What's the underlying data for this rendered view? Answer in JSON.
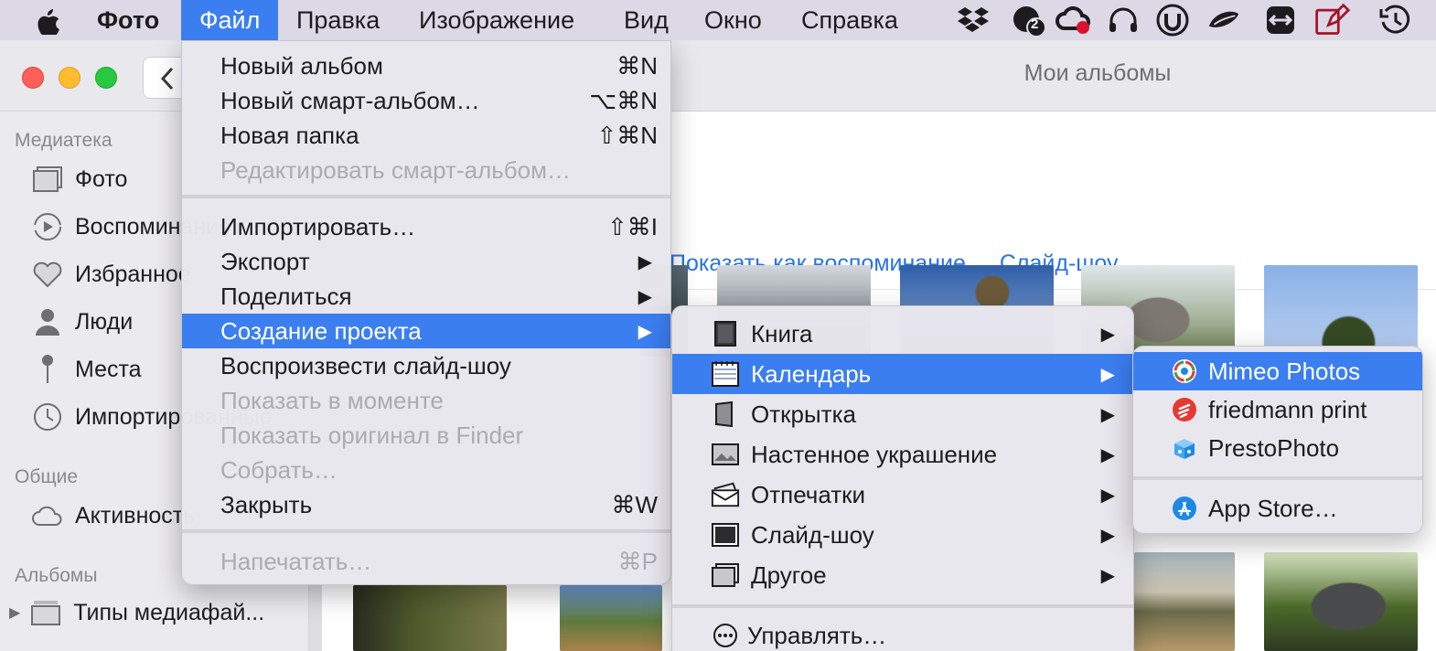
{
  "menubar": {
    "app_name": "Фото",
    "items": [
      "Файл",
      "Правка",
      "Изображение",
      "Вид",
      "Окно",
      "Справка"
    ],
    "active_item": "Файл",
    "status_icons": [
      "dropbox-icon",
      "badge-app-icon",
      "creative-cloud-icon",
      "headphones-icon",
      "utorrent-icon",
      "sync-app-icon",
      "rotate-icon",
      "teamviewer-icon",
      "note-edit-icon",
      "time-machine-icon"
    ],
    "badge_count": "2"
  },
  "window": {
    "title": "Мои альбомы"
  },
  "sidebar": {
    "sections": [
      {
        "heading": "Медиатека",
        "items": [
          {
            "label": "Фото",
            "icon": "photos-icon"
          },
          {
            "label": "Воспоминания",
            "icon": "memories-icon"
          },
          {
            "label": "Избранное",
            "icon": "heart-icon"
          },
          {
            "label": "Люди",
            "icon": "person-icon"
          },
          {
            "label": "Места",
            "icon": "pin-icon"
          },
          {
            "label": "Импортированные",
            "icon": "clock-icon"
          }
        ]
      },
      {
        "heading": "Общие",
        "items": [
          {
            "label": "Активность",
            "icon": "cloud-icon"
          }
        ]
      },
      {
        "heading": "Альбомы",
        "items": [
          {
            "label": "Типы медиафай...",
            "icon": "folder-stack-icon"
          }
        ]
      }
    ]
  },
  "main": {
    "links": [
      "Показать как воспоминание",
      "Слайд-шоу"
    ]
  },
  "file_menu": {
    "items": [
      {
        "label": "Новый альбом",
        "shortcut": "⌘N",
        "disabled": false
      },
      {
        "label": "Новый смарт-альбом…",
        "shortcut": "⌥⌘N",
        "disabled": false
      },
      {
        "label": "Новая папка",
        "shortcut": "⇧⌘N",
        "disabled": false
      },
      {
        "label": "Редактировать смарт-альбом…",
        "shortcut": "",
        "disabled": true
      },
      {
        "label": "Импортировать…",
        "shortcut": "⇧⌘I",
        "disabled": false
      },
      {
        "label": "Экспорт",
        "submenu": true,
        "disabled": false
      },
      {
        "label": "Поделиться",
        "submenu": true,
        "disabled": false
      },
      {
        "label": "Создание проекта",
        "submenu": true,
        "highlighted": true,
        "disabled": false
      },
      {
        "label": "Воспроизвести слайд-шоу",
        "shortcut": "",
        "disabled": false
      },
      {
        "label": "Показать в моменте",
        "shortcut": "",
        "disabled": true
      },
      {
        "label": "Показать оригинал в Finder",
        "shortcut": "",
        "disabled": true
      },
      {
        "label": "Собрать…",
        "shortcut": "",
        "disabled": true
      },
      {
        "label": "Закрыть",
        "shortcut": "⌘W",
        "disabled": false
      },
      {
        "label": "Напечатать…",
        "shortcut": "⌘P",
        "disabled": true
      }
    ]
  },
  "project_menu": {
    "items": [
      {
        "label": "Книга",
        "icon": "book-icon"
      },
      {
        "label": "Календарь",
        "icon": "calendar-icon",
        "highlighted": true
      },
      {
        "label": "Открытка",
        "icon": "card-icon"
      },
      {
        "label": "Настенное украшение",
        "icon": "wall-decor-icon"
      },
      {
        "label": "Отпечатки",
        "icon": "prints-icon"
      },
      {
        "label": "Слайд-шоу",
        "icon": "slideshow-icon"
      },
      {
        "label": "Другое",
        "icon": "other-icon"
      }
    ],
    "manage_label": "Управлять…"
  },
  "calendar_menu": {
    "items": [
      {
        "label": "Mimeo Photos",
        "icon": "mimeo-icon",
        "highlighted": true
      },
      {
        "label": "friedmann print",
        "icon": "friedmann-icon"
      },
      {
        "label": "PrestoPhoto",
        "icon": "prestophoto-icon"
      }
    ],
    "store_label": "App Store…"
  },
  "colors": {
    "accent": "#3b7ef0",
    "menubar": "#dcd8e6",
    "link": "#2a72e6",
    "disabled_text": "#adabb2"
  }
}
